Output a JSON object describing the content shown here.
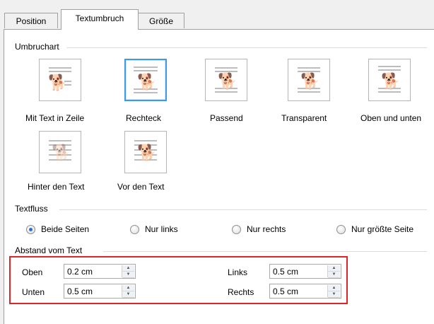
{
  "tabs": [
    {
      "label": "Position"
    },
    {
      "label": "Textumbruch"
    },
    {
      "label": "Größe"
    }
  ],
  "umbruchart": {
    "title": "Umbruchart",
    "items": [
      {
        "label": "Mit Text in Zeile",
        "selected": false
      },
      {
        "label": "Rechteck",
        "selected": true
      },
      {
        "label": "Passend",
        "selected": false
      },
      {
        "label": "Transparent",
        "selected": false
      },
      {
        "label": "Oben und unten",
        "selected": false
      },
      {
        "label": "Hinter den Text",
        "selected": false
      },
      {
        "label": "Vor den Text",
        "selected": false
      }
    ]
  },
  "textfluss": {
    "title": "Textfluss",
    "options": [
      {
        "label": "Beide Seiten",
        "checked": true
      },
      {
        "label": "Nur links",
        "checked": false
      },
      {
        "label": "Nur rechts",
        "checked": false
      },
      {
        "label": "Nur größte Seite",
        "checked": false
      }
    ]
  },
  "abstand": {
    "title": "Abstand vom Text",
    "oben": {
      "label": "Oben",
      "value": "0.2 cm"
    },
    "unten": {
      "label": "Unten",
      "value": "0.5 cm"
    },
    "links": {
      "label": "Links",
      "value": "0.5 cm"
    },
    "rechts": {
      "label": "Rechts",
      "value": "0.5 cm"
    }
  },
  "colors": {
    "selection": "#3c9ae8",
    "highlight": "#e0242c"
  }
}
